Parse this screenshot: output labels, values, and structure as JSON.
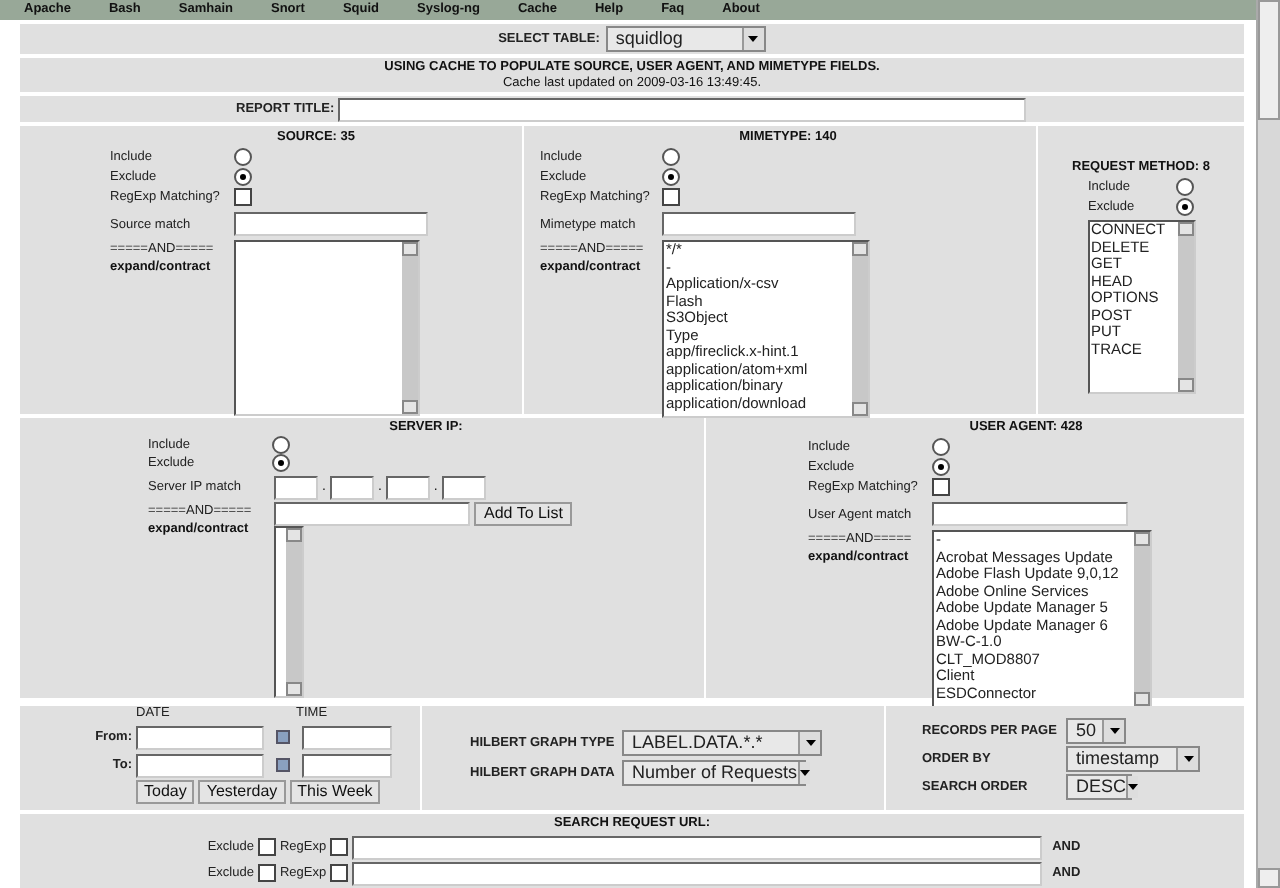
{
  "nav": [
    "Apache",
    "Bash",
    "Samhain",
    "Snort",
    "Squid",
    "Syslog-ng",
    "Cache",
    "Help",
    "Faq",
    "About"
  ],
  "select_table": {
    "label": "SELECT TABLE:",
    "value": "squidlog"
  },
  "cache_notice": {
    "title": "USING CACHE TO POPULATE SOURCE, USER AGENT, AND MIMETYPE FIELDS.",
    "subtitle": "Cache last updated on 2009-03-16 13:49:45."
  },
  "report_title": {
    "label": "REPORT TITLE:"
  },
  "source": {
    "title": "SOURCE: 35",
    "options": [
      {
        "label": "Include",
        "selected": false
      },
      {
        "label": "Exclude",
        "selected": true
      }
    ],
    "regexp": {
      "label": "RegExp Matching?",
      "checked": false
    },
    "match_label": "Source match",
    "and_label": "=====AND=====",
    "expand_label": "expand/contract"
  },
  "mimetype": {
    "title": "MIMETYPE: 140",
    "options": [
      {
        "label": "Include",
        "selected": false
      },
      {
        "label": "Exclude",
        "selected": true
      }
    ],
    "regexp": {
      "label": "RegExp Matching?",
      "checked": false
    },
    "match_label": "Mimetype match",
    "and_label": "=====AND=====",
    "expand_label": "expand/contract",
    "items": [
      "*/*",
      "-",
      "Application/x-csv",
      "Flash",
      "S3Object",
      "Type",
      "app/fireclick.x-hint.1",
      "application/atom+xml",
      "application/binary",
      "application/download"
    ]
  },
  "request_method": {
    "title": "REQUEST METHOD: 8",
    "options": [
      {
        "label": "Include",
        "selected": false
      },
      {
        "label": "Exclude",
        "selected": true
      }
    ],
    "items": [
      "CONNECT",
      "DELETE",
      "GET",
      "HEAD",
      "OPTIONS",
      "POST",
      "PUT",
      "TRACE"
    ]
  },
  "server_ip": {
    "title": "SERVER IP:",
    "options": [
      {
        "label": "Include",
        "selected": false
      },
      {
        "label": "Exclude",
        "selected": true
      }
    ],
    "match_label": "Server IP match",
    "and_label": "=====AND=====",
    "expand_label": "expand/contract",
    "add_button": "Add To List",
    "separators": [
      ".",
      ".",
      "."
    ]
  },
  "user_agent": {
    "title": "USER AGENT: 428",
    "options": [
      {
        "label": "Include",
        "selected": false
      },
      {
        "label": "Exclude",
        "selected": true
      }
    ],
    "regexp": {
      "label": "RegExp Matching?",
      "checked": false
    },
    "match_label": "User Agent match",
    "and_label": "=====AND=====",
    "expand_label": "expand/contract",
    "items": [
      "-",
      "Acrobat Messages Update",
      "Adobe Flash Update 9,0,12",
      "Adobe Online Services",
      "Adobe Update Manager 5",
      "Adobe Update Manager 6",
      "BW-C-1.0",
      "CLT_MOD8807",
      "Client",
      "ESDConnector"
    ]
  },
  "date_range": {
    "date_header": "DATE",
    "time_header": "TIME",
    "rows": [
      {
        "label": "From:"
      },
      {
        "label": "To:"
      }
    ],
    "buttons": [
      "Today",
      "Yesterday",
      "This Week"
    ]
  },
  "hilbert": [
    {
      "label": "HILBERT GRAPH TYPE",
      "value": "LABEL.DATA.*.*"
    },
    {
      "label": "HILBERT GRAPH DATA",
      "value": "Number of Requests"
    }
  ],
  "records": [
    {
      "label": "RECORDS PER PAGE",
      "value": "50"
    },
    {
      "label": "ORDER BY",
      "value": "timestamp"
    },
    {
      "label": "SEARCH ORDER",
      "value": "DESC"
    }
  ],
  "search_url": {
    "title": "SEARCH REQUEST URL:",
    "rows": [
      {
        "exclude_label": "Exclude",
        "exclude_checked": false,
        "regexp_label": "RegExp",
        "regexp_checked": false,
        "and_label": "AND"
      },
      {
        "exclude_label": "Exclude",
        "exclude_checked": false,
        "regexp_label": "RegExp",
        "regexp_checked": false,
        "and_label": "AND"
      }
    ]
  }
}
